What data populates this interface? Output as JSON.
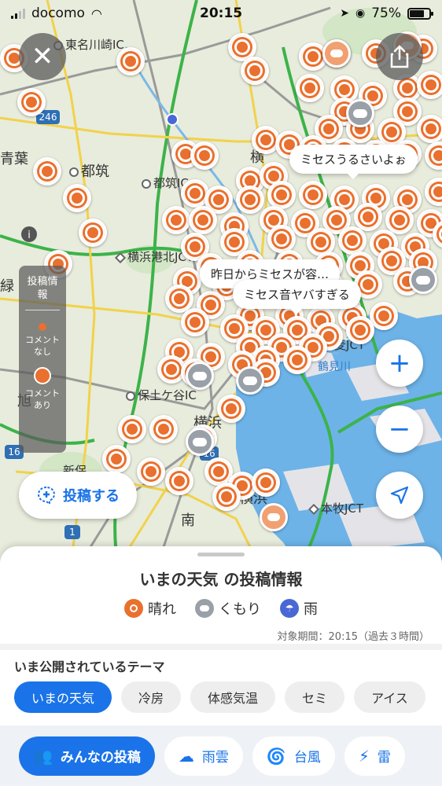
{
  "status_bar": {
    "carrier": "docomo",
    "time": "20:15",
    "battery": "75%"
  },
  "map": {
    "places": [
      {
        "name": "東名川崎IC"
      },
      {
        "name": "都筑"
      },
      {
        "name": "都筑IC"
      },
      {
        "name": "青葉"
      },
      {
        "name": "横浜港北JCT"
      },
      {
        "name": "横"
      },
      {
        "name": "重"
      },
      {
        "name": "保土ケ谷IC"
      },
      {
        "name": "横浜"
      },
      {
        "name": "横浜"
      },
      {
        "name": "新保"
      },
      {
        "name": "南"
      },
      {
        "name": "本牧JCT"
      },
      {
        "name": "生麦JCT"
      },
      {
        "name": "旭"
      },
      {
        "name": "緑"
      }
    ],
    "water_label": "鶴見川",
    "road_shields": [
      "246",
      "16",
      "16",
      "1"
    ],
    "bubbles": [
      "ミセスうるさいよぉ",
      "昨日からミセスが容…",
      "ミセス音ヤバすぎる"
    ]
  },
  "legend_panel": {
    "title": "投稿情報",
    "no_comment": "コメントなし",
    "with_comment": "コメントあり"
  },
  "post_button": {
    "label": "投稿する"
  },
  "sheet": {
    "title": "いまの天気 の投稿情報",
    "legend": [
      {
        "icon": "sun-icon",
        "label": "晴れ"
      },
      {
        "icon": "cloud-icon",
        "label": "くもり"
      },
      {
        "icon": "umbrella-icon",
        "label": "雨"
      }
    ],
    "period": "対象期間：20:15（過去３時間）",
    "theme_title": "いま公開されているテーマ",
    "themes": [
      "いまの天気",
      "冷房",
      "体感気温",
      "セミ",
      "アイス"
    ],
    "active_theme": "いまの天気"
  },
  "bottom_tabs": [
    {
      "icon": "people-icon",
      "label": "みんなの投稿",
      "active": true
    },
    {
      "icon": "rain-cloud-icon",
      "label": "雨雲",
      "active": false
    },
    {
      "icon": "typhoon-icon",
      "label": "台風",
      "active": false
    },
    {
      "icon": "lightning-icon",
      "label": "雷",
      "active": false
    }
  ],
  "colors": {
    "accent": "#1a73e8",
    "sunny_pin": "#e9702e",
    "cloudy_pin": "#9aa0a8",
    "sea": "#6db3e8",
    "land": "#e8ecdc"
  }
}
